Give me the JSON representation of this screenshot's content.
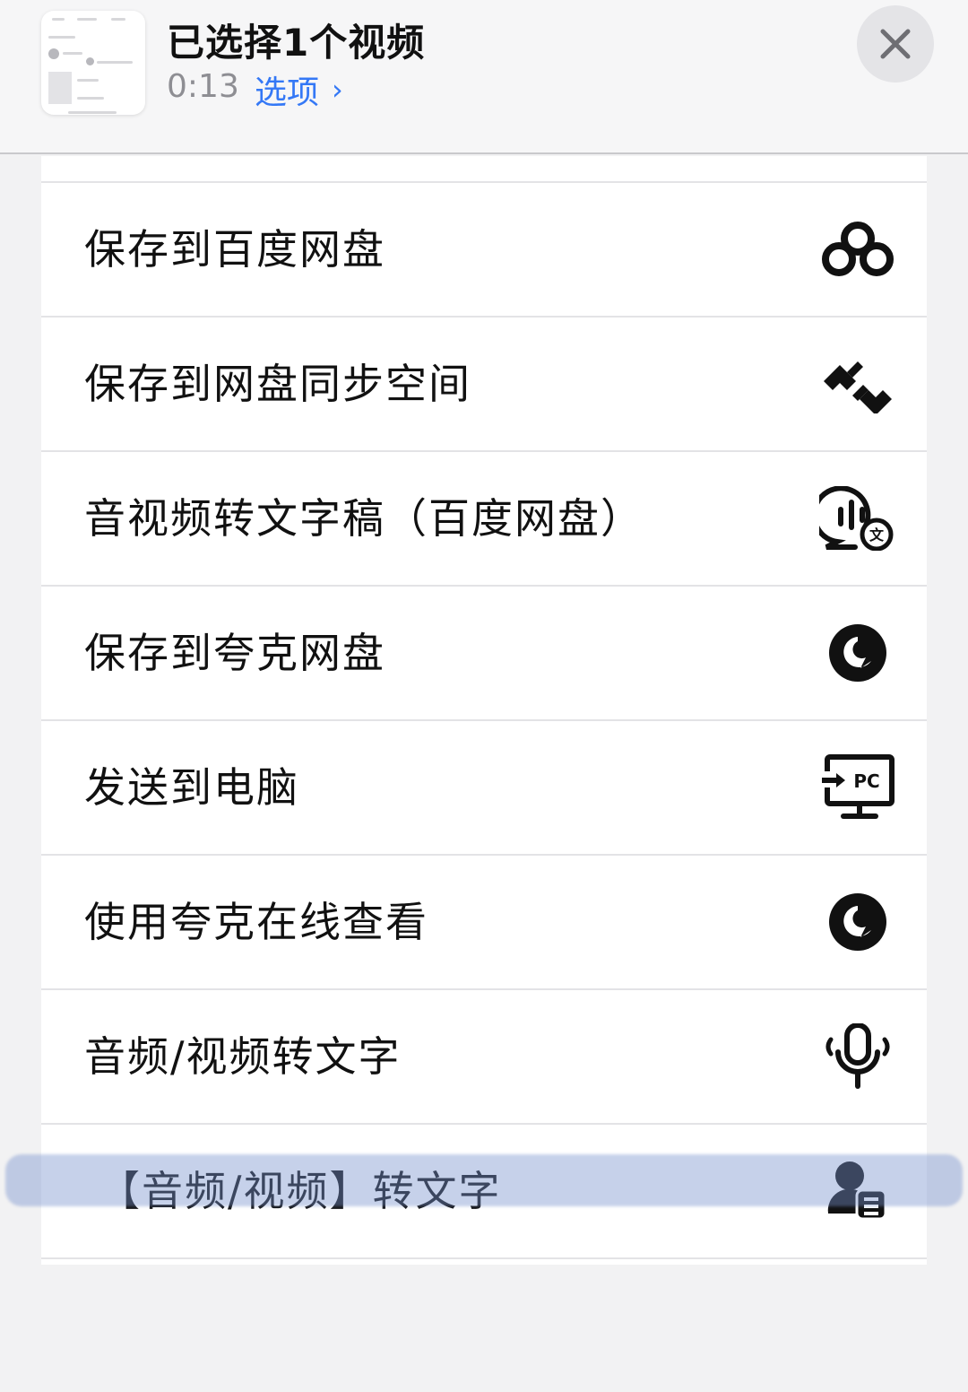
{
  "header": {
    "title": "已选择1个视频",
    "duration": "0:13",
    "options_label": "选项",
    "options_chevron": "›",
    "close_icon": "close-icon",
    "link_color": "#3478f6"
  },
  "actions": [
    {
      "label": "保存到百度网盘",
      "icon": "baidu-netdisk-icon"
    },
    {
      "label": "保存到网盘同步空间",
      "icon": "sync-space-icon"
    },
    {
      "label": "音视频转文字稿（百度网盘）",
      "icon": "transcribe-chat-icon"
    },
    {
      "label": "保存到夸克网盘",
      "icon": "quark-icon"
    },
    {
      "label": "发送到电脑",
      "icon": "send-to-pc-icon",
      "icon_text": "PC"
    },
    {
      "label": "使用夸克在线查看",
      "icon": "quark-icon"
    },
    {
      "label": "音频/视频转文字",
      "icon": "microphone-icon"
    },
    {
      "label": "【音频/视频】转文字",
      "icon": "person-document-icon",
      "highlighted": true
    }
  ],
  "highlight_color": "#7891cd"
}
